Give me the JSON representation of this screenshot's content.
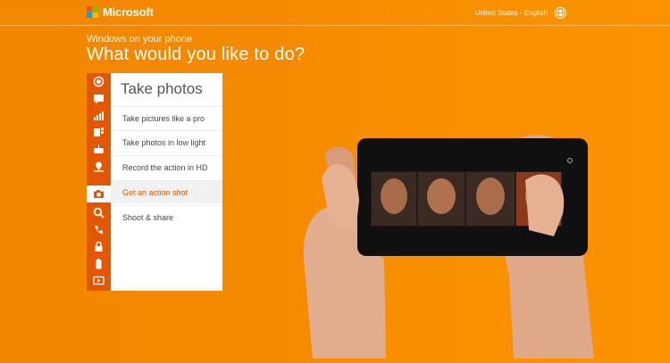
{
  "header": {
    "brand": "Microsoft",
    "locale": "United States - English",
    "logo_colors": [
      "#f25022",
      "#7fba00",
      "#00a4ef",
      "#ffb900"
    ]
  },
  "hero": {
    "subtitle": "Windows on your phone",
    "title": "What would you like to do?"
  },
  "categories": [
    {
      "icon": "record-icon"
    },
    {
      "icon": "message-icon"
    },
    {
      "icon": "chart-icon"
    },
    {
      "icon": "documents-icon"
    },
    {
      "icon": "games-icon"
    },
    {
      "icon": "map-pin-icon"
    },
    {
      "icon": "camera-icon"
    },
    {
      "icon": "search-icon"
    },
    {
      "icon": "phone-icon"
    },
    {
      "icon": "lock-icon"
    },
    {
      "icon": "battery-icon"
    },
    {
      "icon": "share-screen-icon"
    }
  ],
  "menu": {
    "title": "Take photos",
    "items": [
      {
        "label": "Take pictures like a pro"
      },
      {
        "label": "Take photos in low light"
      },
      {
        "label": "Record the action in HD"
      },
      {
        "label": "Get an action shot"
      },
      {
        "label": "Shoot & share"
      }
    ]
  },
  "colors": {
    "background": "#f58a00",
    "accent": "#e35700"
  }
}
